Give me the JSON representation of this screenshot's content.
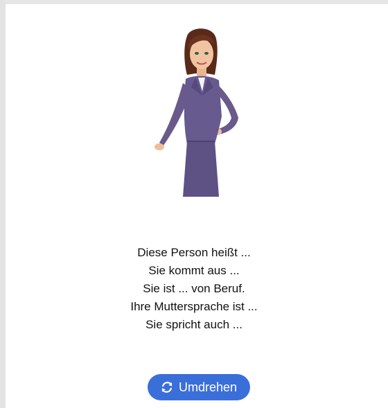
{
  "illustration": {
    "icon": "businesswoman-illustration"
  },
  "prompt_lines": [
    "Diese Person heißt ...",
    "Sie kommt aus ...",
    "Sie ist ... von Beruf.",
    "Ihre Muttersprache ist ...",
    "Sie spricht auch ..."
  ],
  "flip_button": {
    "label": "Umdrehen",
    "icon": "refresh-icon",
    "color": "#3a6fd9"
  }
}
